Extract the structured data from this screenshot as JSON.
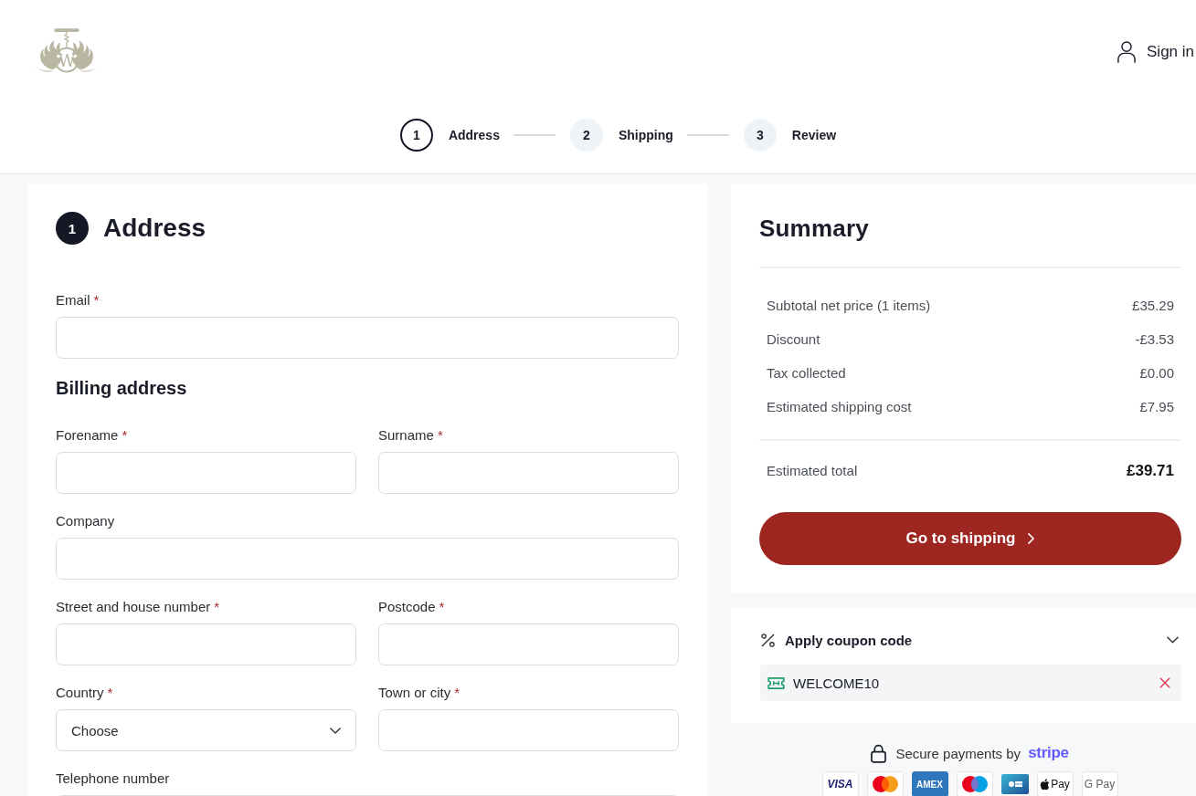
{
  "header": {
    "logo_monogram": "W",
    "sign_in": "Sign in"
  },
  "stepper": [
    {
      "number": "1",
      "label": "Address",
      "selected": true
    },
    {
      "number": "2",
      "label": "Shipping",
      "selected": false
    },
    {
      "number": "3",
      "label": "Review",
      "selected": false
    }
  ],
  "address_form": {
    "step_number": "1",
    "title": "Address",
    "contact_rows": [
      [
        {
          "kind": "text",
          "label": "Email",
          "required_mark": "*"
        }
      ]
    ],
    "billing_title": "Billing address",
    "billing_rows": [
      [
        {
          "kind": "text",
          "label": "Forename",
          "required_mark": "*"
        },
        {
          "kind": "text",
          "label": "Surname",
          "required_mark": "*"
        }
      ],
      [
        {
          "kind": "text",
          "label": "Company"
        }
      ],
      [
        {
          "kind": "text",
          "label": "Street and house number",
          "required_mark": "*"
        },
        {
          "kind": "text",
          "label": "Postcode",
          "required_mark": "*"
        }
      ],
      [
        {
          "kind": "select",
          "label": "Country",
          "required_mark": "*",
          "value": "Choose"
        },
        {
          "kind": "text",
          "label": "Town or city",
          "required_mark": "*"
        }
      ],
      [
        {
          "kind": "text",
          "label": "Telephone number"
        }
      ]
    ]
  },
  "summary": {
    "title": "Summary",
    "lines": [
      {
        "label": "Subtotal net price (1 items)",
        "value": "£35.29"
      },
      {
        "label": "Discount",
        "value": "-£3.53"
      },
      {
        "label": "Tax collected",
        "value": "£0.00"
      },
      {
        "label": "Estimated shipping cost",
        "value": "£7.95"
      }
    ],
    "total": {
      "label": "Estimated total",
      "value": "£39.71"
    },
    "button": "Go to shipping"
  },
  "coupon": {
    "title": "Apply coupon code",
    "expanded": false,
    "applied": [
      {
        "code": "WELCOME10"
      }
    ]
  },
  "payments": {
    "text": "Secure payments by",
    "provider": "stripe",
    "methods": [
      {
        "kind": "visa",
        "label": "VISA"
      },
      {
        "kind": "mastercard"
      },
      {
        "kind": "amex",
        "label": "AMEX"
      },
      {
        "kind": "maestro"
      },
      {
        "kind": "cb"
      },
      {
        "kind": "applepay",
        "label": "Pay"
      },
      {
        "kind": "googlepay",
        "label": "G Pay"
      }
    ]
  }
}
